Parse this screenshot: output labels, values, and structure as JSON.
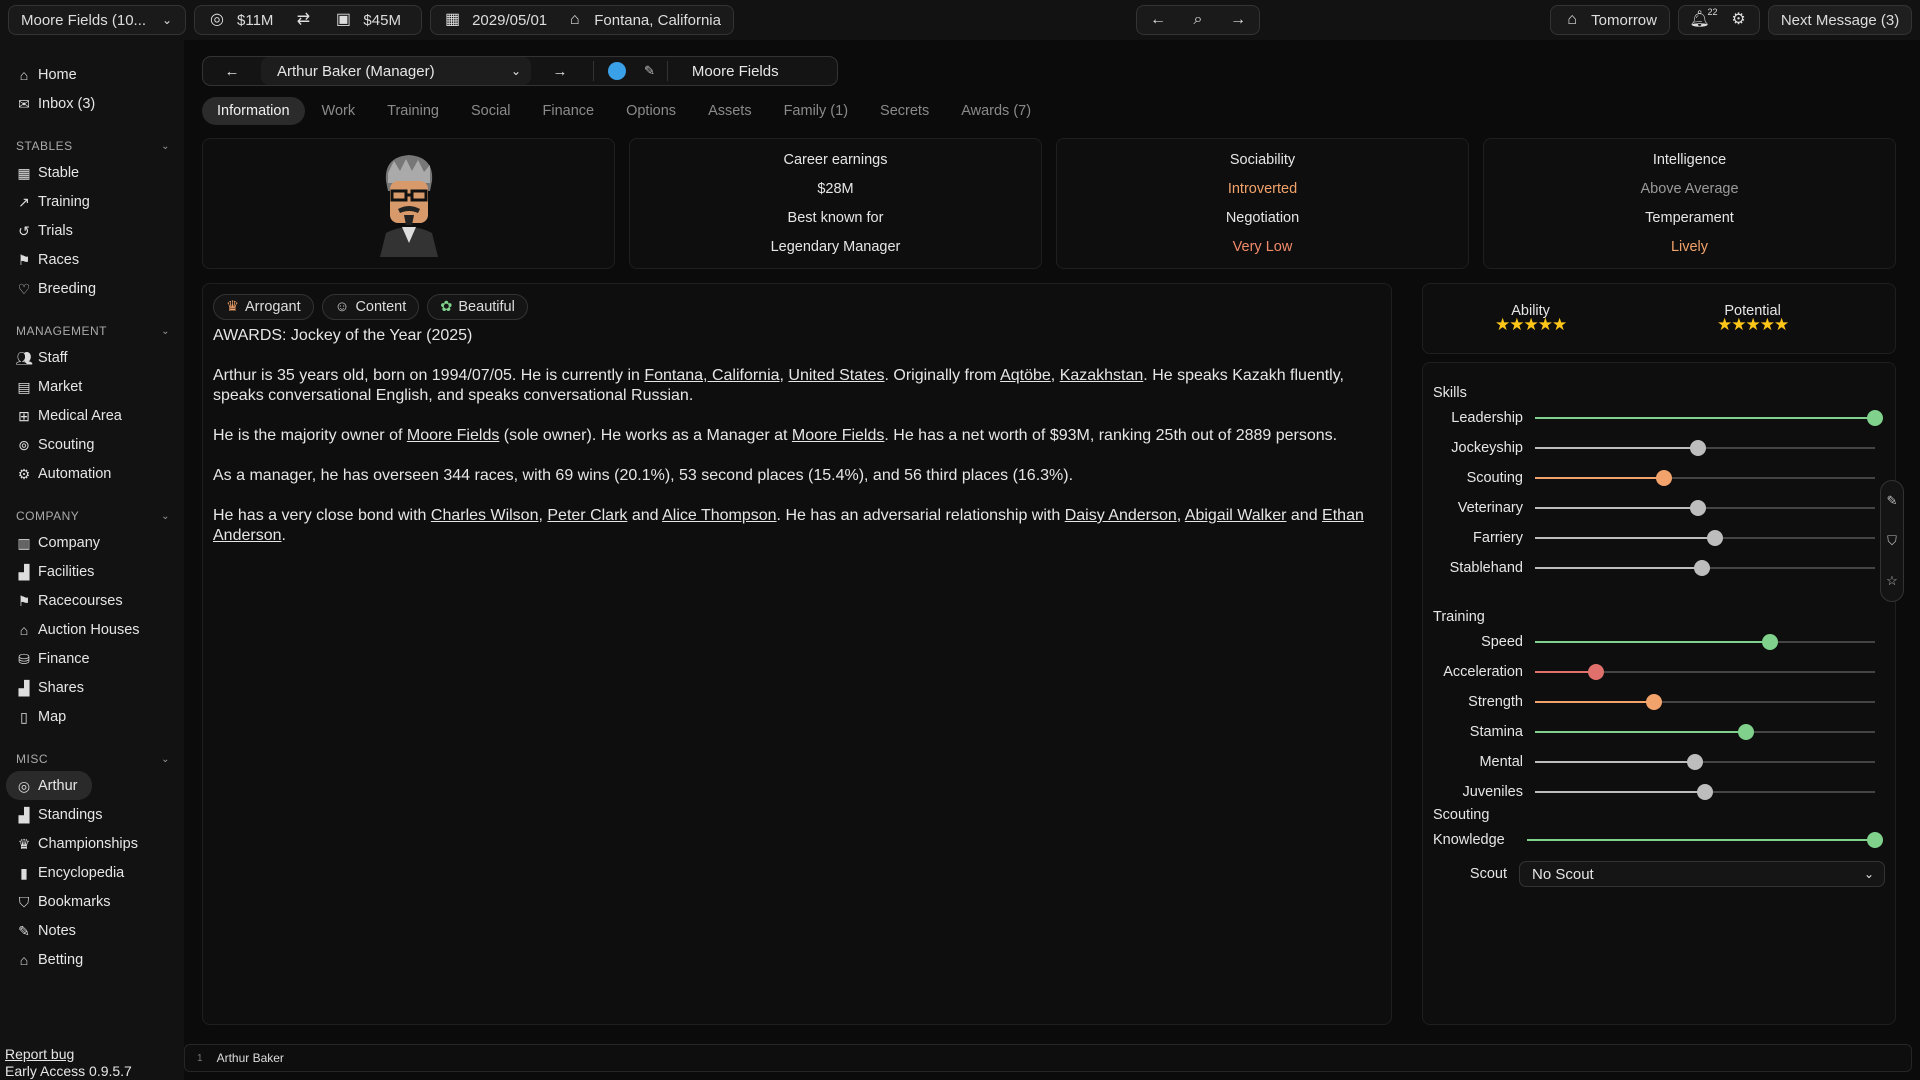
{
  "topbar": {
    "stable_select": "Moore Fields (10...",
    "cash": "$11M",
    "bank": "$45M",
    "date": "2029/05/01",
    "location": "Fontana, California",
    "tomorrow": "Tomorrow",
    "notif_count": "22",
    "next_message": "Next Message (3)"
  },
  "sidebar": {
    "top": [
      {
        "label": "Home",
        "icon": "home-icon"
      },
      {
        "label": "Inbox (3)",
        "icon": "inbox-icon"
      }
    ],
    "sections": [
      {
        "title": "STABLES",
        "items": [
          "Stable",
          "Training",
          "Trials",
          "Races",
          "Breeding"
        ]
      },
      {
        "title": "MANAGEMENT",
        "items": [
          "Staff",
          "Market",
          "Medical Area",
          "Scouting",
          "Automation"
        ]
      },
      {
        "title": "COMPANY",
        "items": [
          "Company",
          "Facilities",
          "Racecourses",
          "Auction Houses",
          "Finance",
          "Shares",
          "Map"
        ]
      },
      {
        "title": "MISC",
        "items": [
          "Arthur",
          "Standings",
          "Championships",
          "Encyclopedia",
          "Bookmarks",
          "Notes",
          "Betting"
        ]
      }
    ],
    "report_bug": "Report bug",
    "version": "Early Access 0.9.5.7"
  },
  "header": {
    "person_select": "Arthur Baker (Manager)",
    "stable_name": "Moore Fields"
  },
  "tabs": [
    "Information",
    "Work",
    "Training",
    "Social",
    "Finance",
    "Options",
    "Assets",
    "Family (1)",
    "Secrets",
    "Awards (7)"
  ],
  "stats": {
    "career_earnings_label": "Career earnings",
    "career_earnings": "$28M",
    "best_known_label": "Best known for",
    "best_known": "Legendary Manager",
    "sociability_label": "Sociability",
    "sociability": "Introverted",
    "negotiation_label": "Negotiation",
    "negotiation": "Very Low",
    "intelligence_label": "Intelligence",
    "intelligence": "Above Average",
    "temperament_label": "Temperament",
    "temperament": "Lively"
  },
  "traits": [
    "Arrogant",
    "Content",
    "Beautiful"
  ],
  "bio": {
    "awards": "AWARDS: Jockey of the Year (2025)",
    "p1a": "Arthur is 35 years old, born on 1994/07/05. He is currently in ",
    "p1_loc1": "Fontana, California",
    "p1_sep1": ", ",
    "p1_loc2": "United States",
    "p1b": ". Originally from ",
    "p1_loc3": "Aqtöbe",
    "p1_sep2": ", ",
    "p1_loc4": "Kazakhstan",
    "p1c": ". He speaks Kazakh fluently, speaks conversational English, and speaks conversational Russian.",
    "p2a": "He is the majority owner of ",
    "p2_link1": "Moore Fields",
    "p2b": " (sole owner). He works as a Manager at ",
    "p2_link2": "Moore Fields",
    "p2c": ". He has a net worth of $93M, ranking 25th out of 2889 persons.",
    "p3": "As a manager, he has overseen 344 races, with 69 wins (20.1%), 53 second places (15.4%), and 56 third places (16.3%).",
    "p4a": "He has a very close bond with ",
    "p4_l1": "Charles Wilson",
    "p4_s1": ", ",
    "p4_l2": "Peter Clark",
    "p4_s2": " and ",
    "p4_l3": "Alice Thompson",
    "p4b": ". He has an adversarial relationship with ",
    "p4_l4": "Daisy Anderson",
    "p4_s3": ", ",
    "p4_l5": "Abigail Walker",
    "p4_s4": " and ",
    "p4_l6": "Ethan Anderson",
    "p4c": "."
  },
  "ratings": {
    "ability_label": "Ability",
    "ability_stars": "★★★★★",
    "potential_label": "Potential",
    "potential_stars": "★★★★★"
  },
  "skills": {
    "skills_title": "Skills",
    "skills": [
      {
        "name": "Leadership",
        "value": 1.0,
        "color": "#7fd18b"
      },
      {
        "name": "Jockeyship",
        "value": 0.48,
        "color": "#bdbdbd"
      },
      {
        "name": "Scouting",
        "value": 0.38,
        "color": "#f2a36b"
      },
      {
        "name": "Veterinary",
        "value": 0.48,
        "color": "#bdbdbd"
      },
      {
        "name": "Farriery",
        "value": 0.53,
        "color": "#bdbdbd"
      },
      {
        "name": "Stablehand",
        "value": 0.49,
        "color": "#bdbdbd"
      }
    ],
    "training_title": "Training",
    "training": [
      {
        "name": "Speed",
        "value": 0.69,
        "color": "#7fd18b"
      },
      {
        "name": "Acceleration",
        "value": 0.18,
        "color": "#e0706b"
      },
      {
        "name": "Strength",
        "value": 0.35,
        "color": "#f2a36b"
      },
      {
        "name": "Stamina",
        "value": 0.62,
        "color": "#7fd18b"
      },
      {
        "name": "Mental",
        "value": 0.47,
        "color": "#bdbdbd"
      },
      {
        "name": "Juveniles",
        "value": 0.5,
        "color": "#bdbdbd"
      }
    ],
    "scouting_title": "Scouting",
    "knowledge_label": "Knowledge",
    "knowledge_value": 1.0,
    "knowledge_color": "#7fd18b",
    "scout_label": "Scout",
    "scout_value": "No Scout"
  },
  "statusbar": {
    "index": "1",
    "name": "Arthur Baker"
  }
}
